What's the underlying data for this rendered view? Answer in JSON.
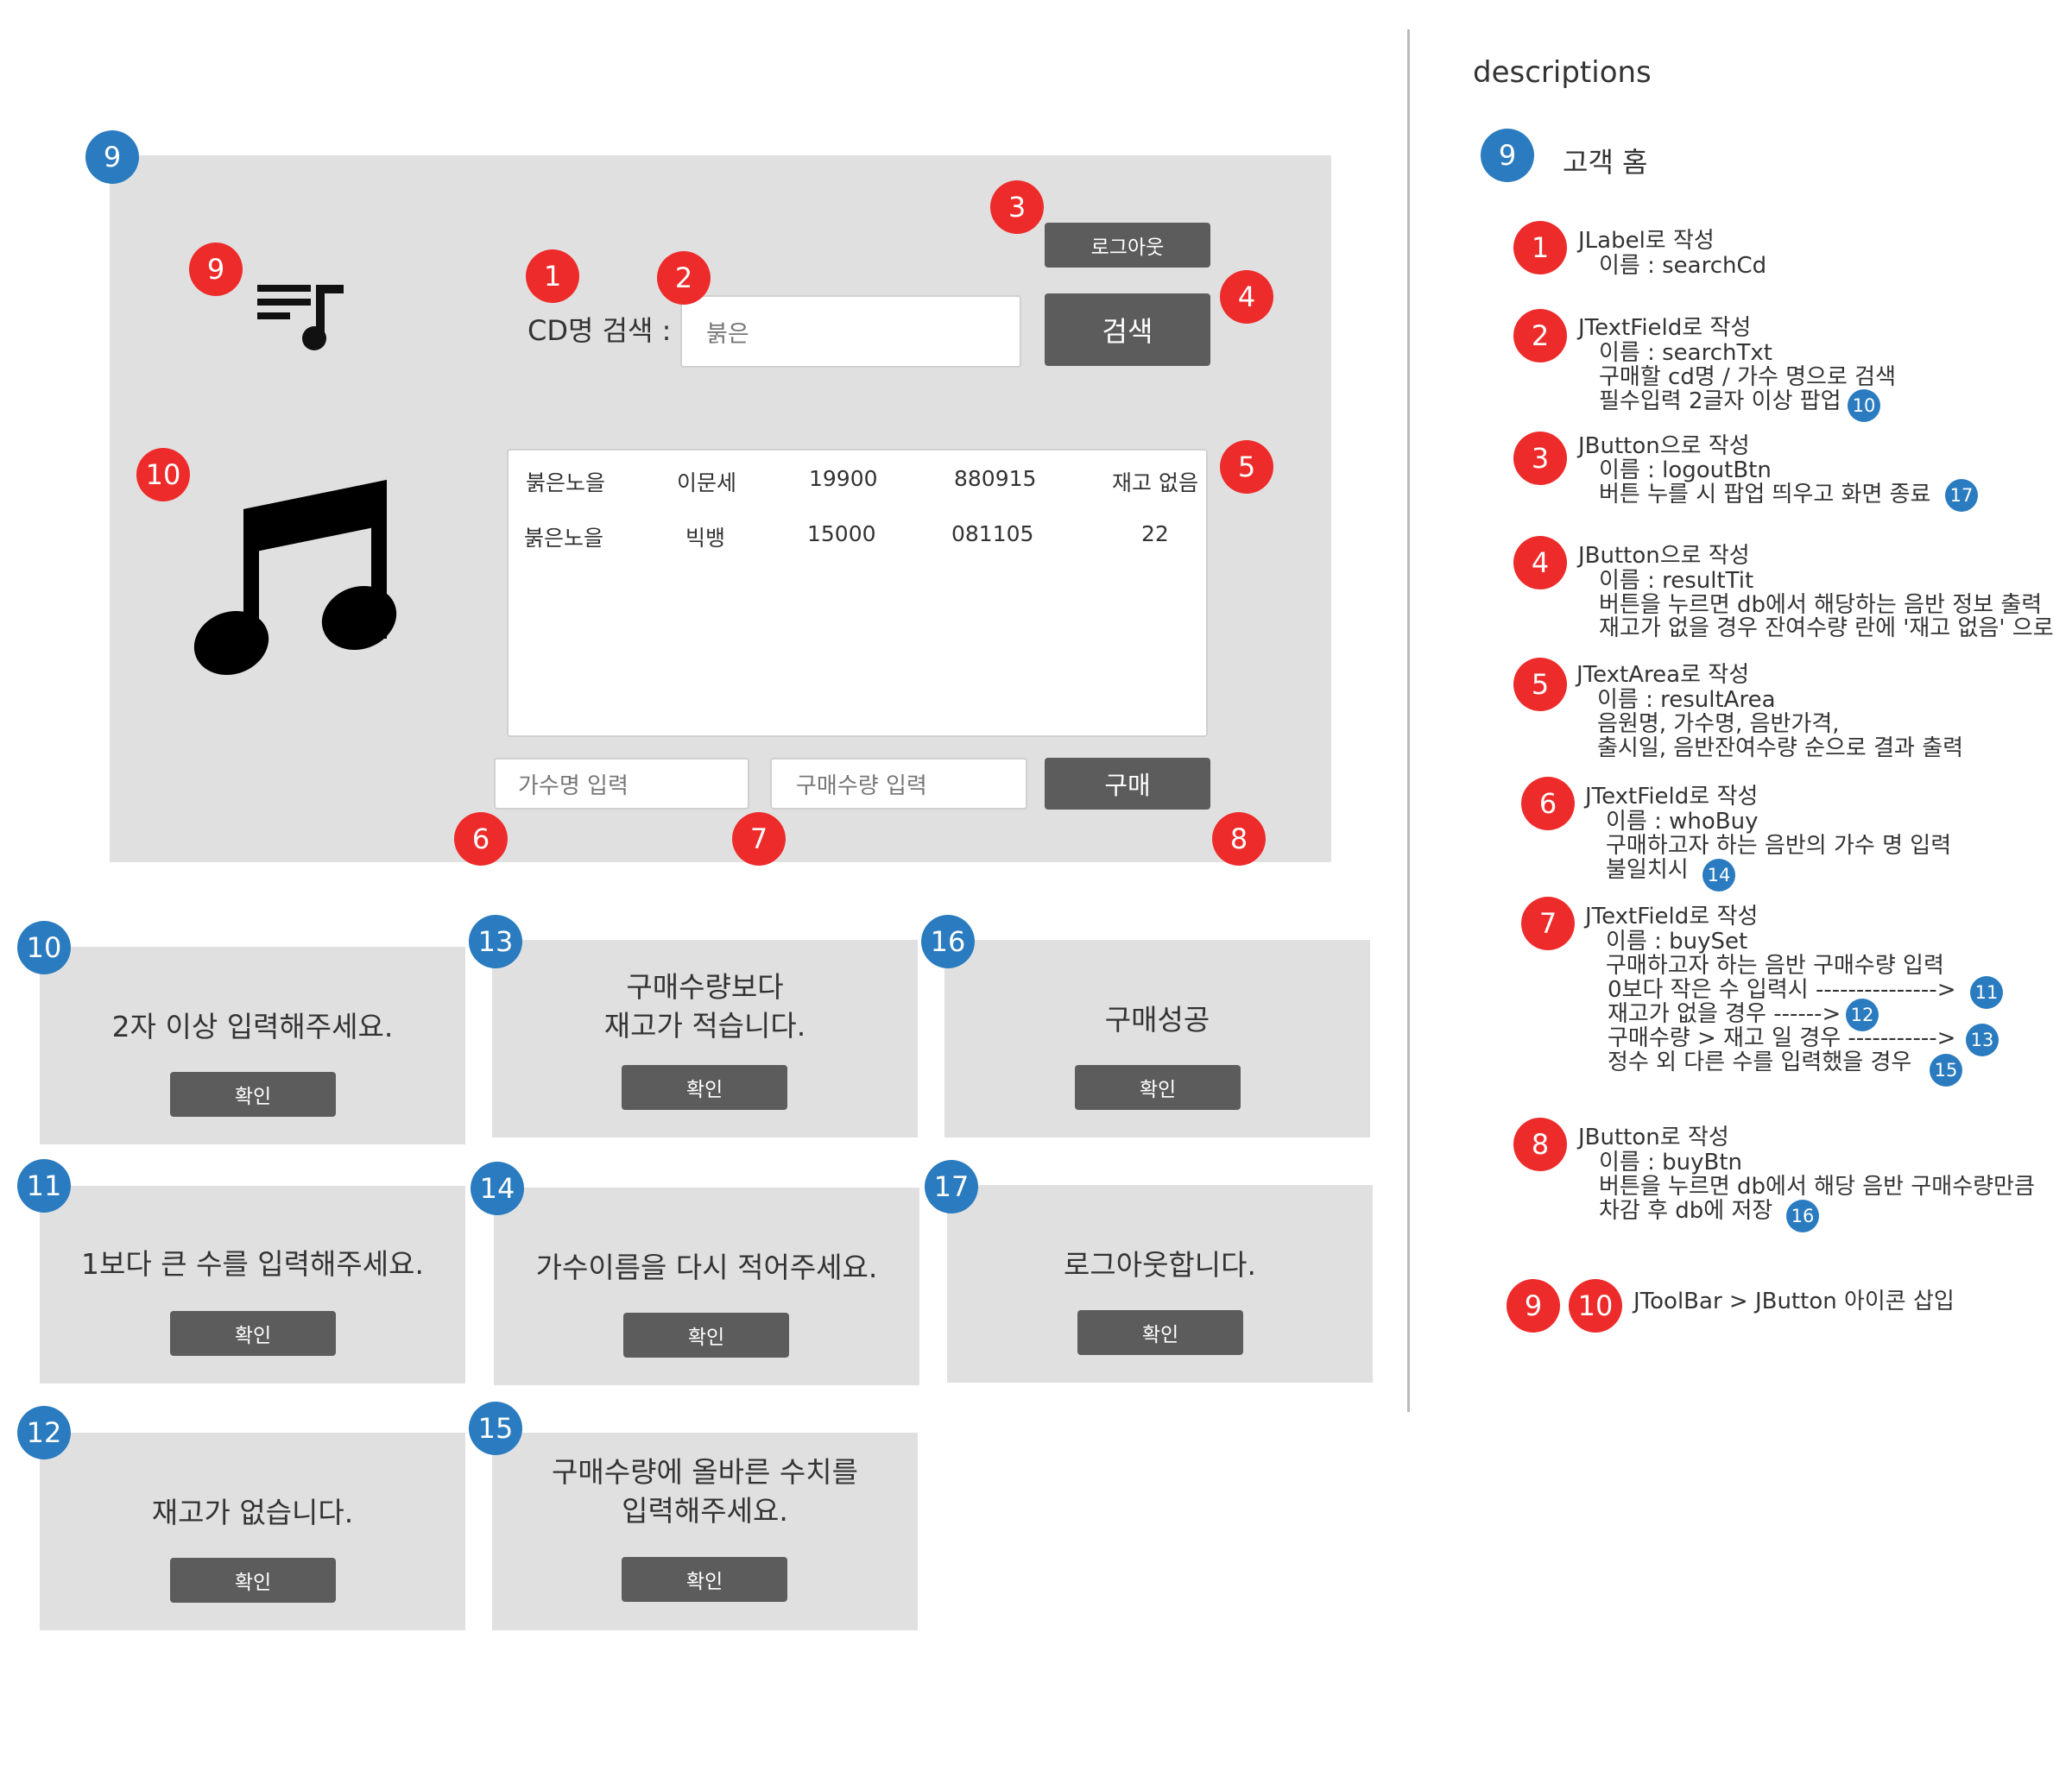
{
  "main_window": {
    "marker": "9",
    "logout_label": "로그아웃",
    "search_label": "CD명 검색 :",
    "search_value": "붉은",
    "search_button": "검색",
    "toolbar_icon": "playlist-music-icon",
    "music_icon": "music-note-icon",
    "results": [
      [
        "붉은노을",
        "이문세",
        "19900",
        "880915",
        "재고 없음"
      ],
      [
        "붉은노을",
        "빅뱅",
        "15000",
        "081105",
        "22"
      ]
    ],
    "singer_placeholder": "가수명 입력",
    "qty_placeholder": "구매수량 입력",
    "buy_button": "구매",
    "markers": {
      "m1": "1",
      "m2": "2",
      "m3": "3",
      "m4": "4",
      "m5": "5",
      "m6": "6",
      "m7": "7",
      "m8": "8",
      "m9": "9",
      "m10": "10"
    }
  },
  "dialogs": [
    {
      "number": "10",
      "line1": "2자 이상 입력해주세요.",
      "line2": "",
      "ok": "확인"
    },
    {
      "number": "13",
      "line1": "구매수량보다",
      "line2": "재고가 적습니다.",
      "ok": "확인"
    },
    {
      "number": "16",
      "line1": "구매성공",
      "line2": "",
      "ok": "확인"
    },
    {
      "number": "11",
      "line1": "1보다 큰 수를 입력해주세요.",
      "line2": "",
      "ok": "확인"
    },
    {
      "number": "14",
      "line1": "가수이름을 다시 적어주세요.",
      "line2": "",
      "ok": "확인"
    },
    {
      "number": "17",
      "line1": "로그아웃합니다.",
      "line2": "",
      "ok": "확인"
    },
    {
      "number": "12",
      "line1": "재고가 없습니다.",
      "line2": "",
      "ok": "확인"
    },
    {
      "number": "15",
      "line1": "구매수량에 올바른 수치를",
      "line2": "입력해주세요.",
      "ok": "확인"
    }
  ],
  "descriptions": {
    "heading": "descriptions",
    "home_number": "9",
    "home_title": "고객 홈",
    "items": [
      {
        "number": "1",
        "lines": [
          "JLabel로 작성",
          "이름 : searchCd"
        ]
      },
      {
        "number": "2",
        "lines": [
          "JTextField로 작성",
          "이름 : searchTxt",
          "구매할 cd명 / 가수 명으로 검색",
          "필수입력 2글자 이상 팝업"
        ],
        "refs": [
          "10"
        ]
      },
      {
        "number": "3",
        "lines": [
          "JButton으로 작성",
          "이름 : logoutBtn",
          "버튼 누를 시 팝업 띄우고 화면 종료"
        ],
        "refs": [
          "17"
        ]
      },
      {
        "number": "4",
        "lines": [
          "JButton으로 작성",
          "이름 : resultTit",
          "버튼을 누르면 db에서 해당하는 음반 정보 출력",
          "재고가 없을 경우 잔여수량 란에 '재고 없음' 으로"
        ]
      },
      {
        "number": "5",
        "lines": [
          "JTextArea로 작성",
          "이름 : resultArea",
          "음원명, 가수명, 음반가격,",
          "출시일, 음반잔여수량 순으로 결과 출력"
        ]
      },
      {
        "number": "6",
        "lines": [
          "JTextField로 작성",
          "이름 : whoBuy",
          "구매하고자 하는 음반의 가수 명 입력",
          "불일치시"
        ],
        "refs": [
          "14"
        ]
      },
      {
        "number": "7",
        "lines": [
          "JTextField로 작성",
          "이름 : buySet",
          "구매하고자 하는 음반 구매수량 입력",
          "0보다 작은 수 입력시 --------------->",
          "재고가 없을 경우 ------>",
          "구매수량 > 재고 일 경우 ----------->",
          "정수 외 다른 수를 입력했을 경우"
        ],
        "refs": [
          "11",
          "12",
          "13",
          "15"
        ]
      },
      {
        "number": "8",
        "lines": [
          "JButton로 작성",
          "이름 : buyBtn",
          "버튼을 누르면 db에서 해당 음반 구매수량만큼",
          "차감 후 db에 저장"
        ],
        "refs": [
          "16"
        ]
      }
    ],
    "toolbar_numbers": [
      "9",
      "10"
    ],
    "toolbar_text": "JToolBar > JButton 아이콘 삽입"
  },
  "colors": {
    "red_marker": "#ee2b2b",
    "blue_marker": "#2a7bbf",
    "panel_gray": "#e0e0e0",
    "button_gray": "#5c5c5c"
  }
}
